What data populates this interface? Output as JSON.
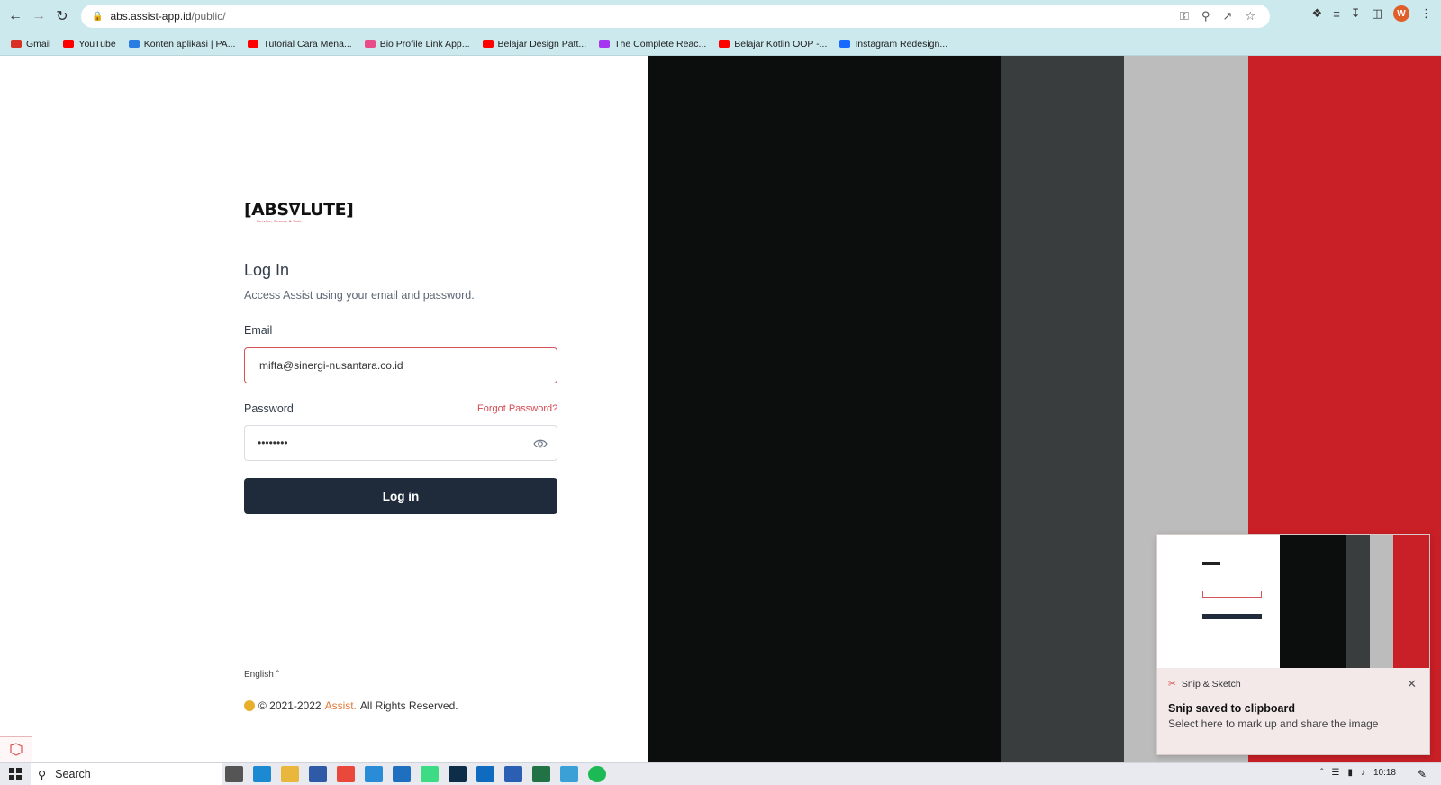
{
  "browser": {
    "url_host": "abs.assist-app.id",
    "url_path": "/public/",
    "profile_initial": "W"
  },
  "bookmarks": [
    {
      "label": "Gmail",
      "icon": "gmail-icon",
      "color": "#d93025"
    },
    {
      "label": "YouTube",
      "icon": "youtube-icon",
      "color": "#ff0000"
    },
    {
      "label": "Konten aplikasi | PA...",
      "icon": "play-console-icon",
      "color": "#2a7de1"
    },
    {
      "label": "Tutorial Cara Mena...",
      "icon": "youtube-icon",
      "color": "#ff0000"
    },
    {
      "label": "Bio Profile Link App...",
      "icon": "dribbble-icon",
      "color": "#ea4c89"
    },
    {
      "label": "Belajar Design Patt...",
      "icon": "youtube-icon",
      "color": "#ff0000"
    },
    {
      "label": "The Complete Reac...",
      "icon": "udemy-icon",
      "color": "#a435f0"
    },
    {
      "label": "Belajar Kotlin OOP -...",
      "icon": "youtube-icon",
      "color": "#ff0000"
    },
    {
      "label": "Instagram Redesign...",
      "icon": "behance-icon",
      "color": "#1769ff"
    }
  ],
  "logo": {
    "text": "[ABS∇LUTE]",
    "tagline": "Service, Secure & Safe"
  },
  "login": {
    "title": "Log In",
    "subtitle": "Access Assist using your email and password.",
    "email_label": "Email",
    "email_value": "mifta@sinergi-nusantara.co.id",
    "password_label": "Password",
    "forgot_label": "Forgot Password?",
    "password_value": "••••••••",
    "submit_label": "Log in"
  },
  "footer": {
    "language": "English",
    "copyright_prefix": "© 2021-2022",
    "brand": "Assist.",
    "copyright_suffix": "All Rights Reserved."
  },
  "stripes": [
    "#0c0d0d",
    "#3a3d3e",
    "#bcbcbc",
    "#c91f26"
  ],
  "toast": {
    "app": "Snip & Sketch",
    "title": "Snip saved to clipboard",
    "message": "Select here to mark up and share the image"
  },
  "taskbar": {
    "search": "Search",
    "time": "10:18"
  },
  "colors": {
    "accent": "#d44b54",
    "button": "#1f2a3a"
  }
}
